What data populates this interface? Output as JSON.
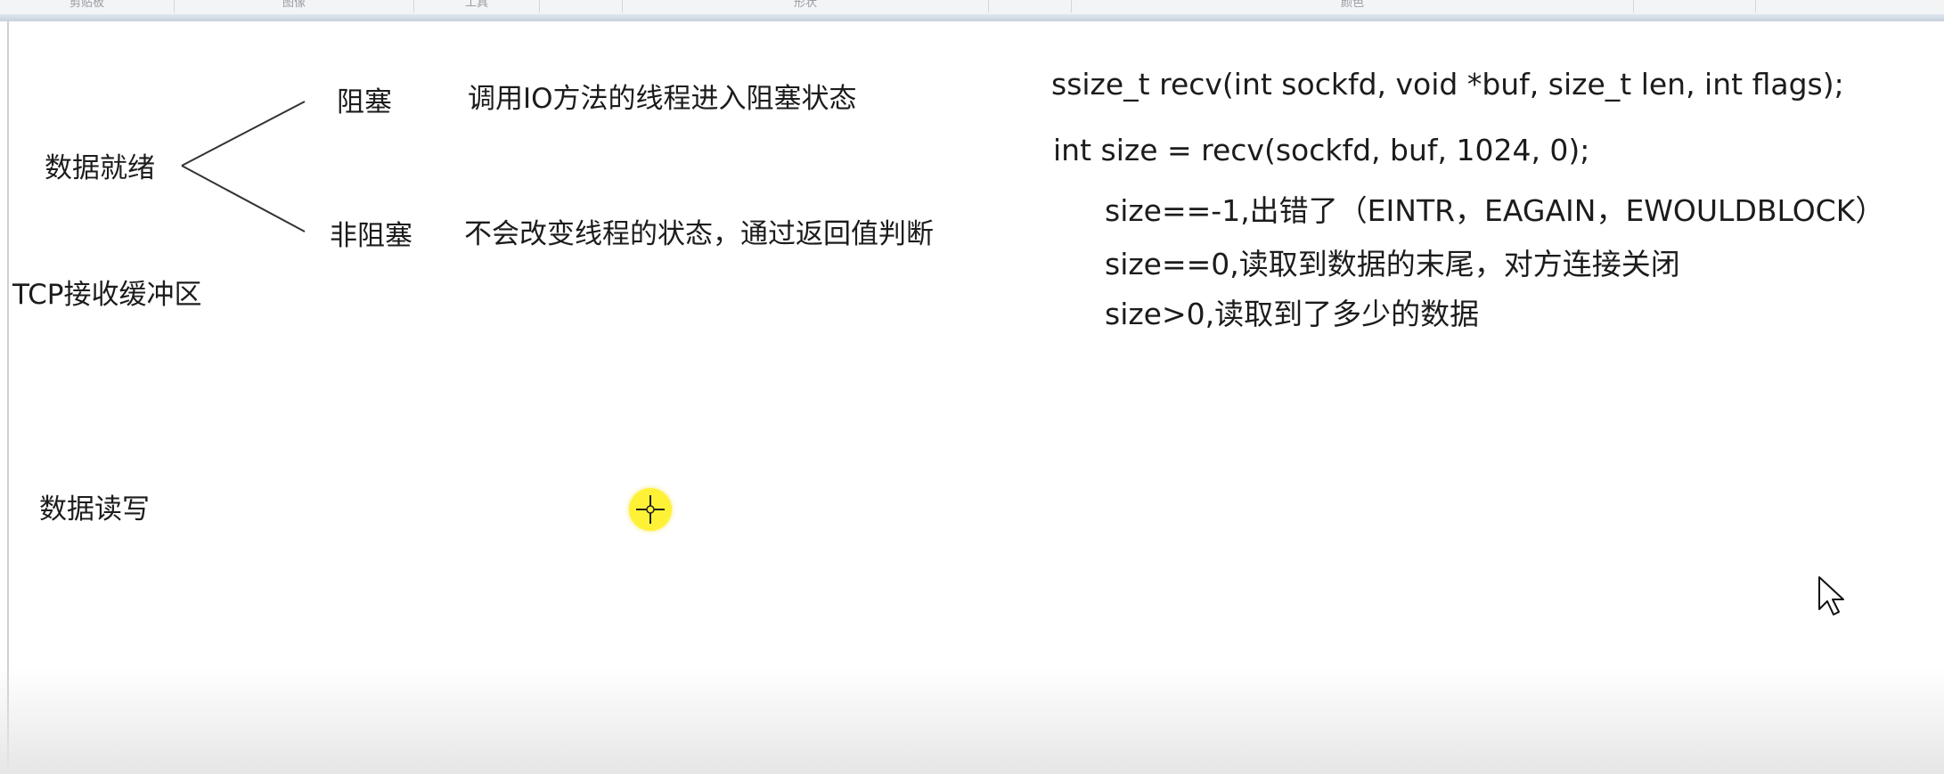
{
  "ribbon": {
    "groups": [
      "剪贴板",
      "图像",
      "工具",
      "形状",
      "颜色"
    ]
  },
  "diagram": {
    "root": "数据就绪",
    "branch_top_label": "阻塞",
    "branch_top_desc": "调用IO方法的线程进入阻塞状态",
    "branch_bottom_label": "非阻塞",
    "branch_bottom_desc": "不会改变线程的状态，通过返回值判断",
    "buffer_label": "TCP接收缓冲区",
    "read_write_label": "数据读写"
  },
  "code": {
    "signature": "ssize_t recv(int sockfd, void *buf, size_t len, int flags);",
    "call": "int size = recv(sockfd, buf, 1024, 0);",
    "cases": [
      "size==-1,出错了（EINTR，EAGAIN，EWOULDBLOCK）",
      "size==0,读取到数据的末尾，对方连接关闭",
      "size>0,读取到了多少的数据"
    ]
  },
  "icons": {
    "pointer": "crosshair-highlight-icon",
    "cursor": "arrow-cursor-icon"
  },
  "colors": {
    "pointer_highlight": "#fff236",
    "text": "#1c1c1c"
  }
}
